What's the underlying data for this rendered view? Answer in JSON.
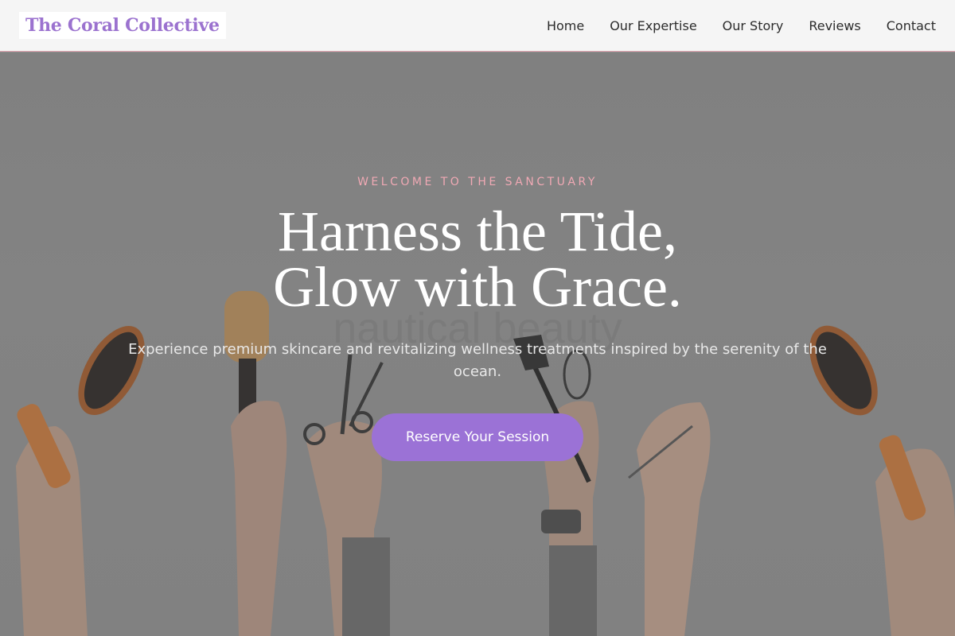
{
  "header": {
    "logo": "The Coral Collective",
    "nav": [
      "Home",
      "Our Expertise",
      "Our Story",
      "Reviews",
      "Contact"
    ]
  },
  "hero": {
    "eyebrow": "WELCOME TO THE SANCTUARY",
    "headline_line1": "Harness the Tide,",
    "headline_line2": "Glow with Grace.",
    "subtitle": "Experience premium skincare and revitalizing wellness treatments inspired by the serenity of the ocean.",
    "cta": "Reserve Your Session",
    "background_text": "nautical beauty"
  },
  "colors": {
    "accent": "#9b72d6",
    "logo": "#9b72cf",
    "eyebrow": "#f0a9b4",
    "header_bg": "#f5f5f5"
  }
}
